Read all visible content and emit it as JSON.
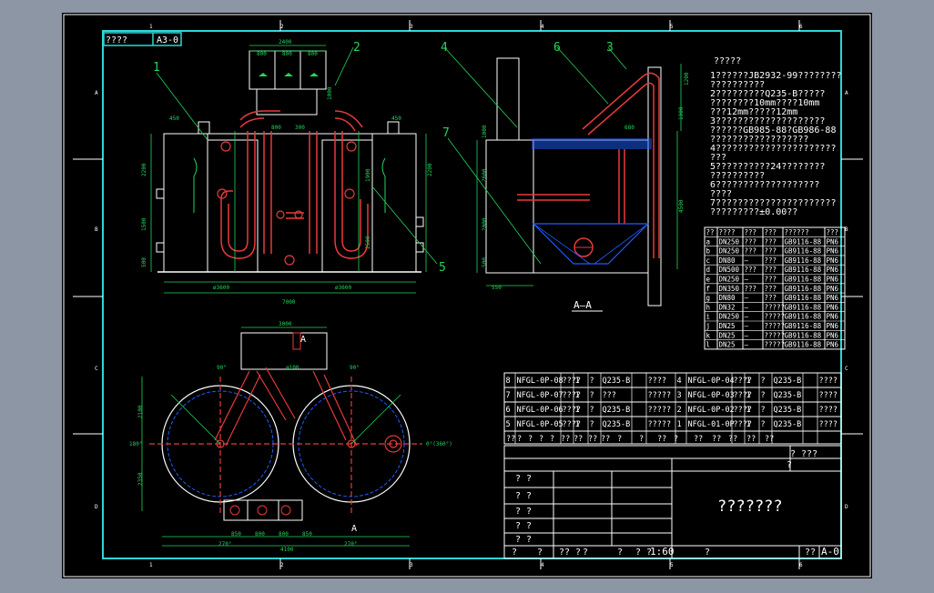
{
  "title_block_top": {
    "label": "????",
    "size": "A3-0"
  },
  "frame_markers": {
    "top": [
      "1",
      "2",
      "3",
      "4",
      "5",
      "6"
    ],
    "bottom": [
      "1",
      "2",
      "3",
      "4",
      "5",
      "6"
    ],
    "left": [
      "A",
      "B",
      "C",
      "D"
    ],
    "right": [
      "A",
      "B",
      "C",
      "D"
    ]
  },
  "callouts": [
    "1",
    "2",
    "3",
    "4",
    "5",
    "6",
    "7"
  ],
  "elevation_dims": {
    "d2400": "2400",
    "d800a": "800",
    "d800b": "800",
    "d800c": "800",
    "d450l": "450",
    "d450r": "450",
    "d2200l": "2200",
    "d2200r": "2200",
    "d1500": "1500",
    "d1900": "1900",
    "d2500": "2500",
    "d3600l": "ø3600",
    "d3600r": "ø3600",
    "d7000": "7000",
    "d500": "500",
    "d800mid": "800",
    "d300": "300",
    "d1000": "1000"
  },
  "section_dims": {
    "d1200": "1200",
    "d1900": "1900",
    "d4500": "4500",
    "d550": "550",
    "d2000": "2000",
    "d500": "500",
    "d680": "680",
    "d2600": "2600",
    "d1000": "1000"
  },
  "section_label": "A—A",
  "plan_dims": {
    "d3000": "3000",
    "d2100": "2100",
    "d2350": "2350",
    "d4100": "4100",
    "d850a": "850",
    "d800a": "800",
    "d800b": "800",
    "d850b": "850",
    "ang90l": "90°",
    "ang90r": "90°",
    "ang180": "180°",
    "ang0": "0°(360°)",
    "ang270l": "270°",
    "ang270r": "270°",
    "markA": "A",
    "markA2": "A",
    "d100": "ø100"
  },
  "notes": {
    "heading": "?????",
    "lines": [
      "1??????JB2932-99????????",
      "  ??????????",
      "2?????????Q235-B?????",
      "  ????????10mm????10mm",
      "  ???12mm?????12mm",
      "3????????????????????",
      "  ??????GB985-88?GB986-88",
      "  ??????????????????",
      "4??????????????????????",
      "  ???",
      "5??????????24????????",
      "  ??????????",
      "6???????????????????",
      "  ????",
      "7??????????????????????",
      "  ?????????±0.00??"
    ]
  },
  "nozzle_table": {
    "headers": [
      "??",
      "????",
      "???",
      "???",
      "??????",
      "???"
    ],
    "rows": [
      [
        "a",
        "DN250",
        "???",
        "???",
        "GB9116-88",
        "PN6"
      ],
      [
        "b",
        "DN250",
        "???",
        "???",
        "GB9116-88",
        "PN6"
      ],
      [
        "c",
        "DN80",
        "—",
        "???",
        "GB9116-88",
        "PN6"
      ],
      [
        "d",
        "DN500",
        "???",
        "???",
        "GB9116-88",
        "PN6"
      ],
      [
        "e",
        "DN250",
        "—",
        "???",
        "GB9116-88",
        "PN6"
      ],
      [
        "f",
        "DN350",
        "???",
        "???",
        "GB9116-88",
        "PN6"
      ],
      [
        "g",
        "DN80",
        "—",
        "???",
        "GB9116-88",
        "PN6"
      ],
      [
        "h",
        "DN32",
        "—",
        "?????",
        "GB9116-88",
        "PN6"
      ],
      [
        "i",
        "DN250",
        "—",
        "?????",
        "GB9116-88",
        "PN6"
      ],
      [
        "j",
        "DN25",
        "—",
        "?????",
        "GB9116-88",
        "PN6"
      ],
      [
        "k",
        "DN25",
        "—",
        "?????",
        "GB9116-88",
        "PN6"
      ],
      [
        "l",
        "DN25",
        "—",
        "?????",
        "GB9116-88",
        "PN6"
      ]
    ]
  },
  "bom": {
    "rows": [
      [
        "8",
        "NFGL-0P-08",
        "????",
        "1",
        "?",
        "Q235-B",
        "",
        "????",
        "4",
        "NFGL-0P-04",
        "????",
        "1",
        "?",
        "Q235-B",
        "",
        "????"
      ],
      [
        "7",
        "NFGL-0P-07",
        "????",
        "1",
        "?",
        "???",
        "",
        "?????",
        "3",
        "NFGL-0P-03",
        "????",
        "1",
        "?",
        "Q235-B",
        "",
        "????"
      ],
      [
        "6",
        "NFGL-0P-06",
        "????",
        "1",
        "?",
        "Q235-B",
        "",
        "?????",
        "2",
        "NFGL-0P-02",
        "????",
        "1",
        "?",
        "Q235-B",
        "",
        "????"
      ],
      [
        "5",
        "NFGL-0P-05",
        "????",
        "1",
        "?",
        "Q235-B",
        "",
        "?????",
        "1",
        "NFGL-01-0P",
        "????",
        "1",
        "?",
        "Q235-B",
        "",
        "????"
      ]
    ],
    "header": [
      "??",
      "?",
      "?",
      "?",
      "?",
      "??",
      "??",
      "??",
      "??",
      "?",
      "?",
      "??",
      "?",
      "??",
      "??",
      "??",
      "??",
      "??"
    ]
  },
  "title_block": {
    "company": "? ???",
    "company2": "?",
    "drawing_name": "???????",
    "sign_rows": [
      "? ?",
      "? ?",
      "? ?",
      "? ?",
      "? ?"
    ],
    "scale_label": "? ?",
    "scale_value": "1:60",
    "sheet_label": "??",
    "sheet_code": "A-0",
    "bottom_left": [
      "?",
      "?",
      "?? ?",
      "?",
      "?",
      "?"
    ]
  }
}
